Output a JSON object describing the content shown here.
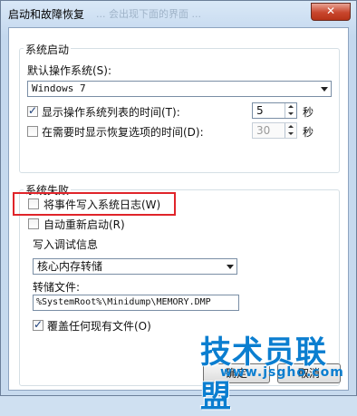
{
  "window": {
    "title": "启动和故障恢复",
    "blurred_title_text": "... 会出现下面的界面 ...",
    "close_glyph": "✕"
  },
  "startup": {
    "group_title": "系统启动",
    "default_os_label": "默认操作系统(S):",
    "default_os_value": "Windows 7",
    "show_os_list_label": "显示操作系统列表的时间(T):",
    "show_os_list_checked": true,
    "show_os_list_value": "5",
    "show_os_list_unit": "秒",
    "show_recovery_label": "在需要时显示恢复选项的时间(D):",
    "show_recovery_checked": false,
    "show_recovery_value": "30",
    "show_recovery_unit": "秒"
  },
  "failure": {
    "group_title": "系统失败",
    "write_event_label": "将事件写入系统日志(W)",
    "write_event_checked": false,
    "auto_restart_label": "自动重新启动(R)",
    "auto_restart_checked": false,
    "debug_info_title": "写入调试信息",
    "debug_type_value": "核心内存转储",
    "dump_file_label": "转储文件:",
    "dump_file_value": "%SystemRoot%\\Minidump\\MEMORY.DMP",
    "overwrite_label": "覆盖任何现有文件(O)",
    "overwrite_checked": true
  },
  "buttons": {
    "ok_label": "确定",
    "cancel_label": "取消"
  },
  "watermark": {
    "brand": "技术员联盟",
    "url": "www.jsgho.com"
  },
  "colors": {
    "highlight_border": "#e0242a",
    "watermark": "#0b7ed0"
  }
}
